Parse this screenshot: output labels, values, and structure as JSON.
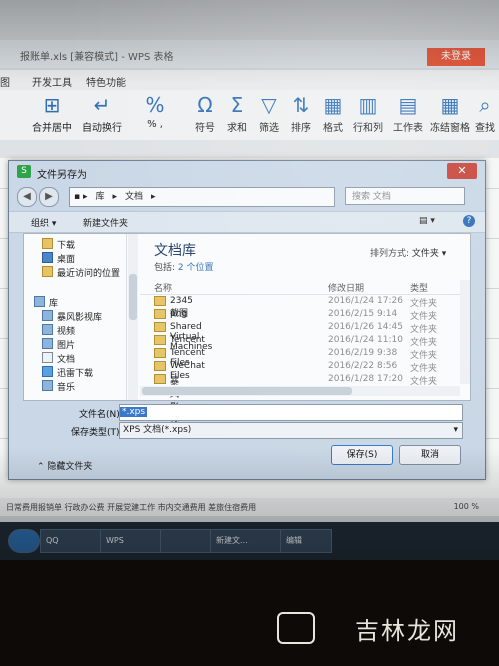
{
  "wps": {
    "window_title": "报账单.xls [兼容模式] - WPS 表格",
    "login_label": "未登录",
    "menus": [
      "图",
      "开发工具",
      "特色功能"
    ],
    "ribbon": [
      {
        "icon": "merge-icon",
        "glyph": "⊞",
        "label": "合并居中"
      },
      {
        "icon": "wrap-icon",
        "glyph": "↵",
        "label": "自动换行"
      },
      {
        "icon": "percent-icon",
        "glyph": "%",
        "label": "% ,"
      },
      {
        "icon": "omega-icon",
        "glyph": "Ω",
        "label": "符号"
      },
      {
        "icon": "sigma-icon",
        "glyph": "Σ",
        "label": "求和"
      },
      {
        "icon": "filter-icon",
        "glyph": "▽",
        "label": "筛选"
      },
      {
        "icon": "sort-icon",
        "glyph": "⇅",
        "label": "排序"
      },
      {
        "icon": "format-icon",
        "glyph": "▦",
        "label": "格式"
      },
      {
        "icon": "rowcol-icon",
        "glyph": "▥",
        "label": "行和列"
      },
      {
        "icon": "sheet-icon",
        "glyph": "▤",
        "label": "工作表"
      },
      {
        "icon": "freeze-icon",
        "glyph": "▦",
        "label": "冻结窗格"
      },
      {
        "icon": "find-icon",
        "glyph": "⌕",
        "label": "查找"
      }
    ],
    "sheet_tabs": "日常费用报销单    行政办公费    开展党建工作    市内交通费用    差旅住宿费用",
    "zoom": "100 %"
  },
  "dialog": {
    "title": "文件另存为",
    "close_glyph": "✕",
    "breadcrumb": [
      "库",
      "文档"
    ],
    "search_placeholder": "搜索 文档",
    "organize_label": "组织 ▾",
    "new_folder_label": "新建文件夹",
    "nav_items": [
      "下载",
      "桌面",
      "最近访问的位置",
      "库",
      "暴风影视库",
      "视频",
      "图片",
      "文档",
      "迅雷下载",
      "音乐"
    ],
    "library_title": "文档库",
    "library_includes_prefix": "包括:",
    "library_includes_link": "2 个位置",
    "arrange_label": "排列方式:",
    "arrange_value": "文件夹 ▾",
    "columns": {
      "name": "名称",
      "date": "修改日期",
      "type": "类型"
    },
    "files": [
      {
        "name": "2345截图",
        "date": "2016/1/24 17:26",
        "type": "文件夹"
      },
      {
        "name": "png",
        "date": "2016/2/15 9:14",
        "type": "文件夹"
      },
      {
        "name": "Shared Virtual Machines",
        "date": "2016/1/26 14:45",
        "type": "文件夹"
      },
      {
        "name": "Tencent",
        "date": "2016/1/24 11:10",
        "type": "文件夹"
      },
      {
        "name": "Tencent Files",
        "date": "2016/2/19 9:38",
        "type": "文件夹"
      },
      {
        "name": "WeChat Files",
        "date": "2016/2/22 8:56",
        "type": "文件夹"
      },
      {
        "name": "暴风影视库",
        "date": "2016/1/28 17:20",
        "type": "文件夹"
      }
    ],
    "filename_label": "文件名(N):",
    "filename_value": "*.xps",
    "savetype_label": "保存类型(T):",
    "savetype_value": "XPS 文档(*.xps)",
    "hide_folders_label": "隐藏文件夹",
    "save_label": "保存(S)",
    "cancel_label": "取消"
  },
  "taskbar": {
    "items": [
      "QQ",
      "WPS",
      "",
      "新建文...",
      "编辑"
    ]
  },
  "watermark": "吉林龙网"
}
